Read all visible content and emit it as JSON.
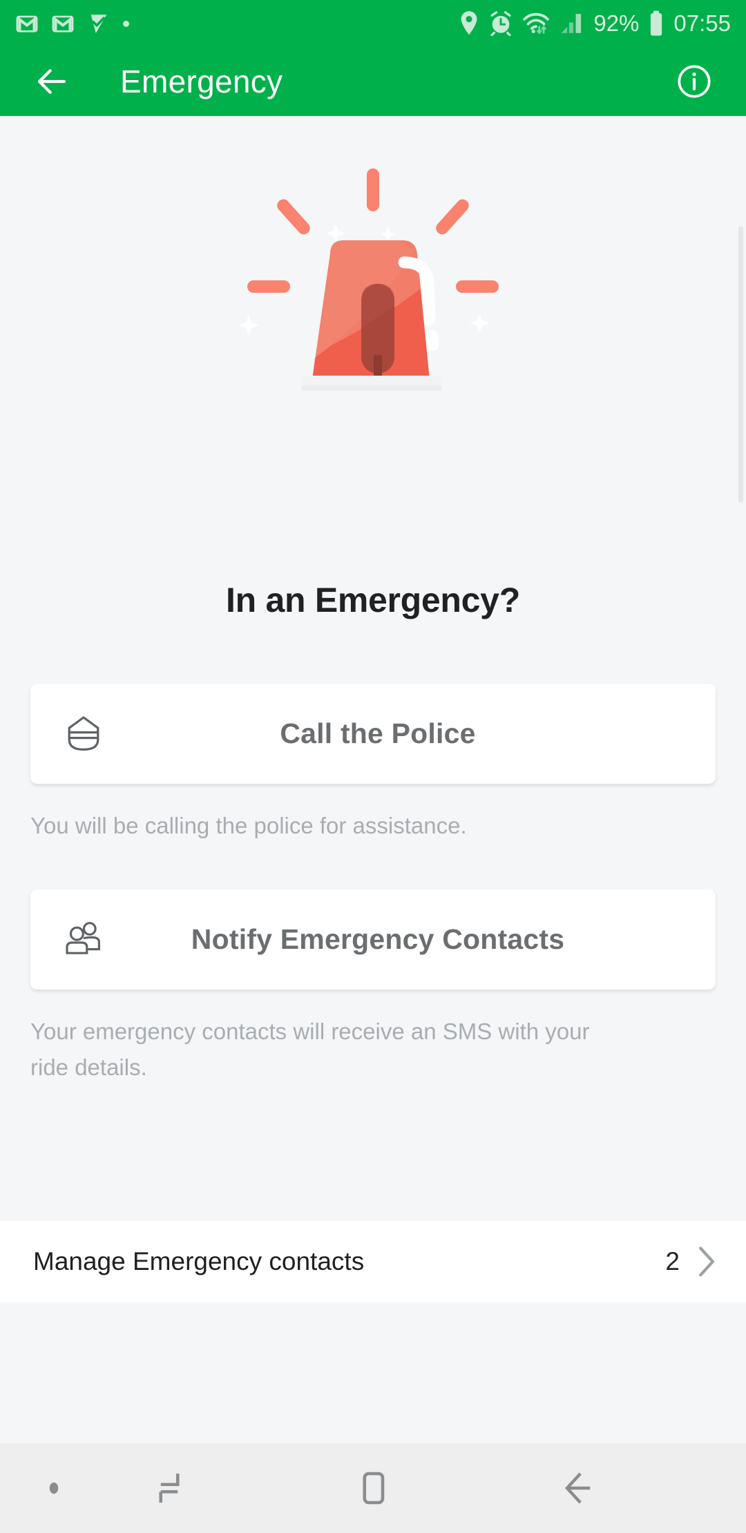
{
  "status_bar": {
    "left_icons": [
      "gmail-icon",
      "gmail-icon",
      "tasks-check-icon",
      "dot-indicator-icon"
    ],
    "right_icons": [
      "location-pin-icon",
      "alarm-clock-icon",
      "wifi-icon",
      "cellular-signal-icon"
    ],
    "battery_percent": "92%",
    "time": "07:55"
  },
  "app_bar": {
    "title": "Emergency",
    "back_icon": "arrow-left-icon",
    "info_icon": "info-circle-icon"
  },
  "main": {
    "illustration": "emergency-siren-light-illustration",
    "heading": "In an Emergency?",
    "actions": [
      {
        "icon": "police-cap-icon",
        "label": "Call the Police",
        "description": "You will be calling the police for assistance."
      },
      {
        "icon": "people-contacts-icon",
        "label": "Notify Emergency Contacts",
        "description": "Your emergency contacts will receive an SMS with your ride details."
      }
    ],
    "manage_row": {
      "label": "Manage Emergency contacts",
      "count": "2",
      "chevron_icon": "chevron-right-icon"
    }
  },
  "nav_bar": {
    "items": [
      "dot-icon",
      "recents-icon",
      "home-icon",
      "back-arrow-icon"
    ]
  },
  "colors": {
    "brand_green": "#00b04a",
    "siren_red": "#f0705c",
    "siren_dark": "#a8483c",
    "page_bg": "#f4f6f7",
    "card_bg": "#ffffff",
    "text_dark": "#1f2124",
    "text_gray": "#6b6e70",
    "text_muted": "#a9adb1"
  }
}
